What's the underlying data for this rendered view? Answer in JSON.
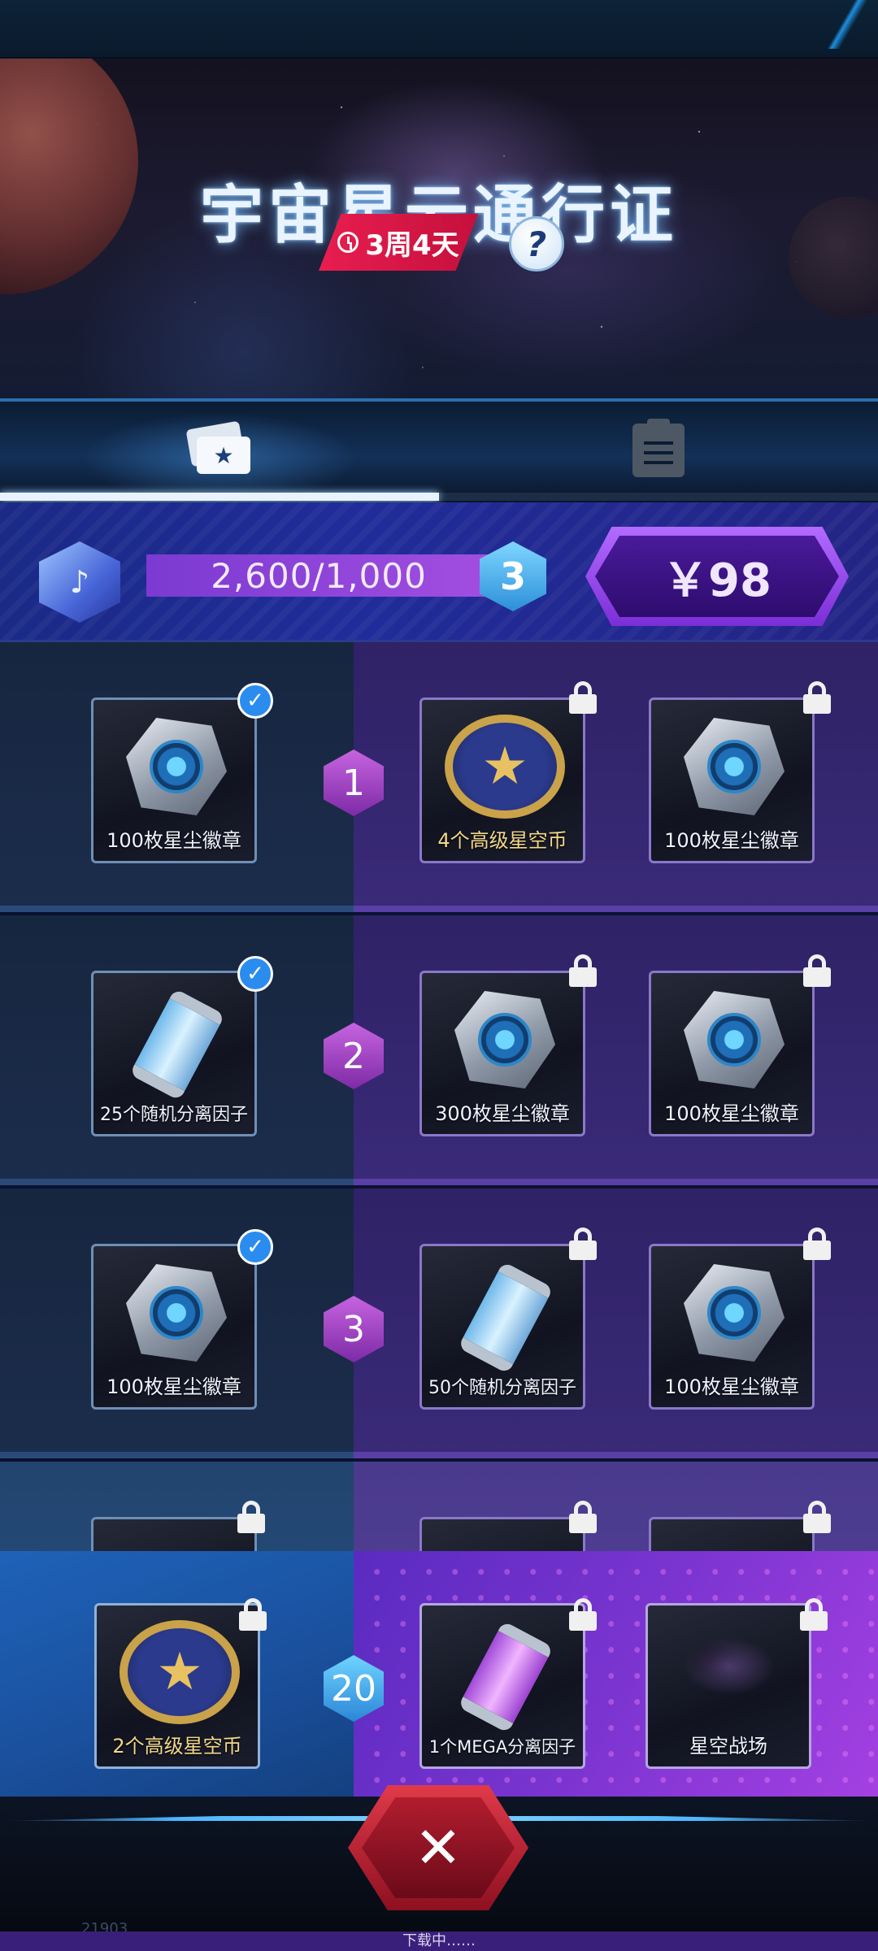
{
  "banner": {
    "title": "宇宙星云通行证",
    "timer": "3周4天",
    "help_label": "?"
  },
  "tabs": [
    {
      "name": "pass-rewards",
      "icon": "ticket-icon",
      "active": true
    },
    {
      "name": "tasks",
      "icon": "clipboard-icon",
      "active": false
    }
  ],
  "tab_progress": 0.5,
  "level": {
    "xp_text": "2,600/1,000",
    "level_number": "3",
    "price": "￥98",
    "currency_icon": "music-cube-icon"
  },
  "rows": [
    {
      "level": "1",
      "free": {
        "label": "100枚星尘徽章",
        "icon": "star-dust-badge-icon",
        "claimed": true
      },
      "premium": [
        {
          "label": "4个高级星空币",
          "icon": "star-coin-icon",
          "locked": true
        },
        {
          "label": "100枚星尘徽章",
          "icon": "star-dust-badge-icon",
          "locked": true
        }
      ]
    },
    {
      "level": "2",
      "free": {
        "label": "25个随机分离因子",
        "icon": "blue-tube-icon",
        "claimed": true
      },
      "premium": [
        {
          "label": "300枚星尘徽章",
          "icon": "star-dust-badge-icon",
          "locked": true
        },
        {
          "label": "100枚星尘徽章",
          "icon": "star-dust-badge-icon",
          "locked": true
        }
      ]
    },
    {
      "level": "3",
      "free": {
        "label": "100枚星尘徽章",
        "icon": "star-dust-badge-icon",
        "claimed": true
      },
      "premium": [
        {
          "label": "50个随机分离因子",
          "icon": "blue-tube-icon",
          "locked": true
        },
        {
          "label": "100枚星尘徽章",
          "icon": "star-dust-badge-icon",
          "locked": true
        }
      ]
    }
  ],
  "final_row": {
    "level": "20",
    "free": {
      "label": "2个高级星空币",
      "icon": "star-coin-icon",
      "locked": true
    },
    "premium": [
      {
        "label": "1个MEGA分离因子",
        "icon": "purple-tube-icon",
        "locked": true
      },
      {
        "label": "星空战场",
        "icon": "nebula-scene-icon",
        "locked": true
      }
    ]
  },
  "close_label": "✕",
  "footer": {
    "version": "21903",
    "status": "下载中……"
  },
  "colors": {
    "claimed_check": "#2b8cf0",
    "premium_bg": "#3a2a78",
    "free_bg": "#1b2d4c",
    "price_button": "#7b2ed6",
    "close_button": "#b21d2f"
  }
}
